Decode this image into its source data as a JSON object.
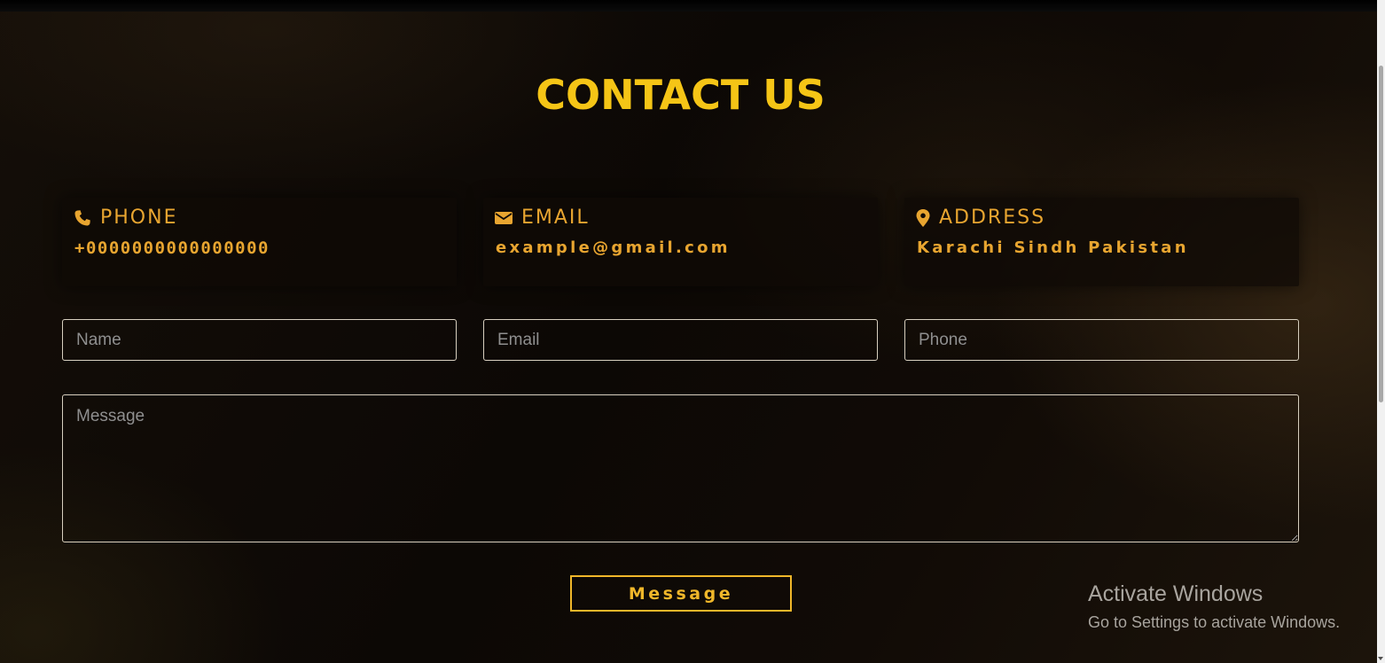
{
  "section": {
    "title": "CONTACT US"
  },
  "cards": [
    {
      "icon": "phone-icon",
      "label": "PHONE",
      "value": "+0000000000000000"
    },
    {
      "icon": "envelope-icon",
      "label": "EMAIL",
      "value": "example@gmail.com"
    },
    {
      "icon": "map-marker-icon",
      "label": "ADDRESS",
      "value": "Karachi Sindh Pakistan"
    }
  ],
  "form": {
    "name_placeholder": "Name",
    "email_placeholder": "Email",
    "phone_placeholder": "Phone",
    "message_placeholder": "Message",
    "submit_label": "Message"
  },
  "watermark": {
    "title": "Activate Windows",
    "subtitle": "Go to Settings to activate Windows."
  },
  "colors": {
    "accent": "#f5c516",
    "card_text": "#e8a530",
    "button": "#f0b72a"
  }
}
